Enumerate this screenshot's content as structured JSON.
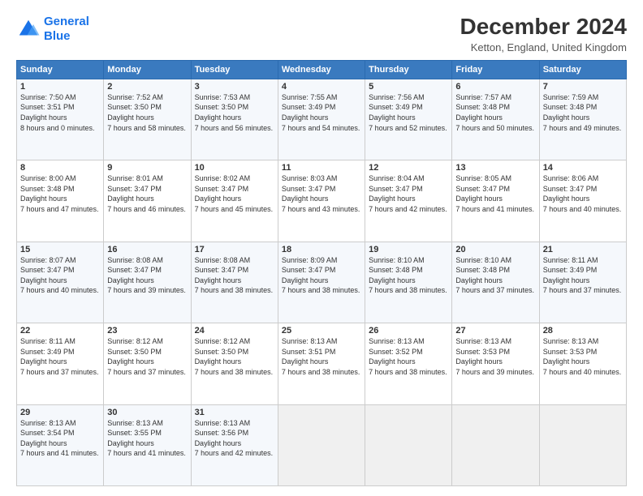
{
  "logo": {
    "text_general": "General",
    "text_blue": "Blue"
  },
  "title": "December 2024",
  "subtitle": "Ketton, England, United Kingdom",
  "header": {
    "days": [
      "Sunday",
      "Monday",
      "Tuesday",
      "Wednesday",
      "Thursday",
      "Friday",
      "Saturday"
    ]
  },
  "weeks": [
    {
      "days": [
        {
          "num": "1",
          "sunrise": "7:50 AM",
          "sunset": "3:51 PM",
          "daylight": "8 hours and 0 minutes."
        },
        {
          "num": "2",
          "sunrise": "7:52 AM",
          "sunset": "3:50 PM",
          "daylight": "7 hours and 58 minutes."
        },
        {
          "num": "3",
          "sunrise": "7:53 AM",
          "sunset": "3:50 PM",
          "daylight": "7 hours and 56 minutes."
        },
        {
          "num": "4",
          "sunrise": "7:55 AM",
          "sunset": "3:49 PM",
          "daylight": "7 hours and 54 minutes."
        },
        {
          "num": "5",
          "sunrise": "7:56 AM",
          "sunset": "3:49 PM",
          "daylight": "7 hours and 52 minutes."
        },
        {
          "num": "6",
          "sunrise": "7:57 AM",
          "sunset": "3:48 PM",
          "daylight": "7 hours and 50 minutes."
        },
        {
          "num": "7",
          "sunrise": "7:59 AM",
          "sunset": "3:48 PM",
          "daylight": "7 hours and 49 minutes."
        }
      ]
    },
    {
      "days": [
        {
          "num": "8",
          "sunrise": "8:00 AM",
          "sunset": "3:48 PM",
          "daylight": "7 hours and 47 minutes."
        },
        {
          "num": "9",
          "sunrise": "8:01 AM",
          "sunset": "3:47 PM",
          "daylight": "7 hours and 46 minutes."
        },
        {
          "num": "10",
          "sunrise": "8:02 AM",
          "sunset": "3:47 PM",
          "daylight": "7 hours and 45 minutes."
        },
        {
          "num": "11",
          "sunrise": "8:03 AM",
          "sunset": "3:47 PM",
          "daylight": "7 hours and 43 minutes."
        },
        {
          "num": "12",
          "sunrise": "8:04 AM",
          "sunset": "3:47 PM",
          "daylight": "7 hours and 42 minutes."
        },
        {
          "num": "13",
          "sunrise": "8:05 AM",
          "sunset": "3:47 PM",
          "daylight": "7 hours and 41 minutes."
        },
        {
          "num": "14",
          "sunrise": "8:06 AM",
          "sunset": "3:47 PM",
          "daylight": "7 hours and 40 minutes."
        }
      ]
    },
    {
      "days": [
        {
          "num": "15",
          "sunrise": "8:07 AM",
          "sunset": "3:47 PM",
          "daylight": "7 hours and 40 minutes."
        },
        {
          "num": "16",
          "sunrise": "8:08 AM",
          "sunset": "3:47 PM",
          "daylight": "7 hours and 39 minutes."
        },
        {
          "num": "17",
          "sunrise": "8:08 AM",
          "sunset": "3:47 PM",
          "daylight": "7 hours and 38 minutes."
        },
        {
          "num": "18",
          "sunrise": "8:09 AM",
          "sunset": "3:47 PM",
          "daylight": "7 hours and 38 minutes."
        },
        {
          "num": "19",
          "sunrise": "8:10 AM",
          "sunset": "3:48 PM",
          "daylight": "7 hours and 38 minutes."
        },
        {
          "num": "20",
          "sunrise": "8:10 AM",
          "sunset": "3:48 PM",
          "daylight": "7 hours and 37 minutes."
        },
        {
          "num": "21",
          "sunrise": "8:11 AM",
          "sunset": "3:49 PM",
          "daylight": "7 hours and 37 minutes."
        }
      ]
    },
    {
      "days": [
        {
          "num": "22",
          "sunrise": "8:11 AM",
          "sunset": "3:49 PM",
          "daylight": "7 hours and 37 minutes."
        },
        {
          "num": "23",
          "sunrise": "8:12 AM",
          "sunset": "3:50 PM",
          "daylight": "7 hours and 37 minutes."
        },
        {
          "num": "24",
          "sunrise": "8:12 AM",
          "sunset": "3:50 PM",
          "daylight": "7 hours and 38 minutes."
        },
        {
          "num": "25",
          "sunrise": "8:13 AM",
          "sunset": "3:51 PM",
          "daylight": "7 hours and 38 minutes."
        },
        {
          "num": "26",
          "sunrise": "8:13 AM",
          "sunset": "3:52 PM",
          "daylight": "7 hours and 38 minutes."
        },
        {
          "num": "27",
          "sunrise": "8:13 AM",
          "sunset": "3:53 PM",
          "daylight": "7 hours and 39 minutes."
        },
        {
          "num": "28",
          "sunrise": "8:13 AM",
          "sunset": "3:53 PM",
          "daylight": "7 hours and 40 minutes."
        }
      ]
    },
    {
      "days": [
        {
          "num": "29",
          "sunrise": "8:13 AM",
          "sunset": "3:54 PM",
          "daylight": "7 hours and 41 minutes."
        },
        {
          "num": "30",
          "sunrise": "8:13 AM",
          "sunset": "3:55 PM",
          "daylight": "7 hours and 41 minutes."
        },
        {
          "num": "31",
          "sunrise": "8:13 AM",
          "sunset": "3:56 PM",
          "daylight": "7 hours and 42 minutes."
        },
        null,
        null,
        null,
        null
      ]
    }
  ]
}
